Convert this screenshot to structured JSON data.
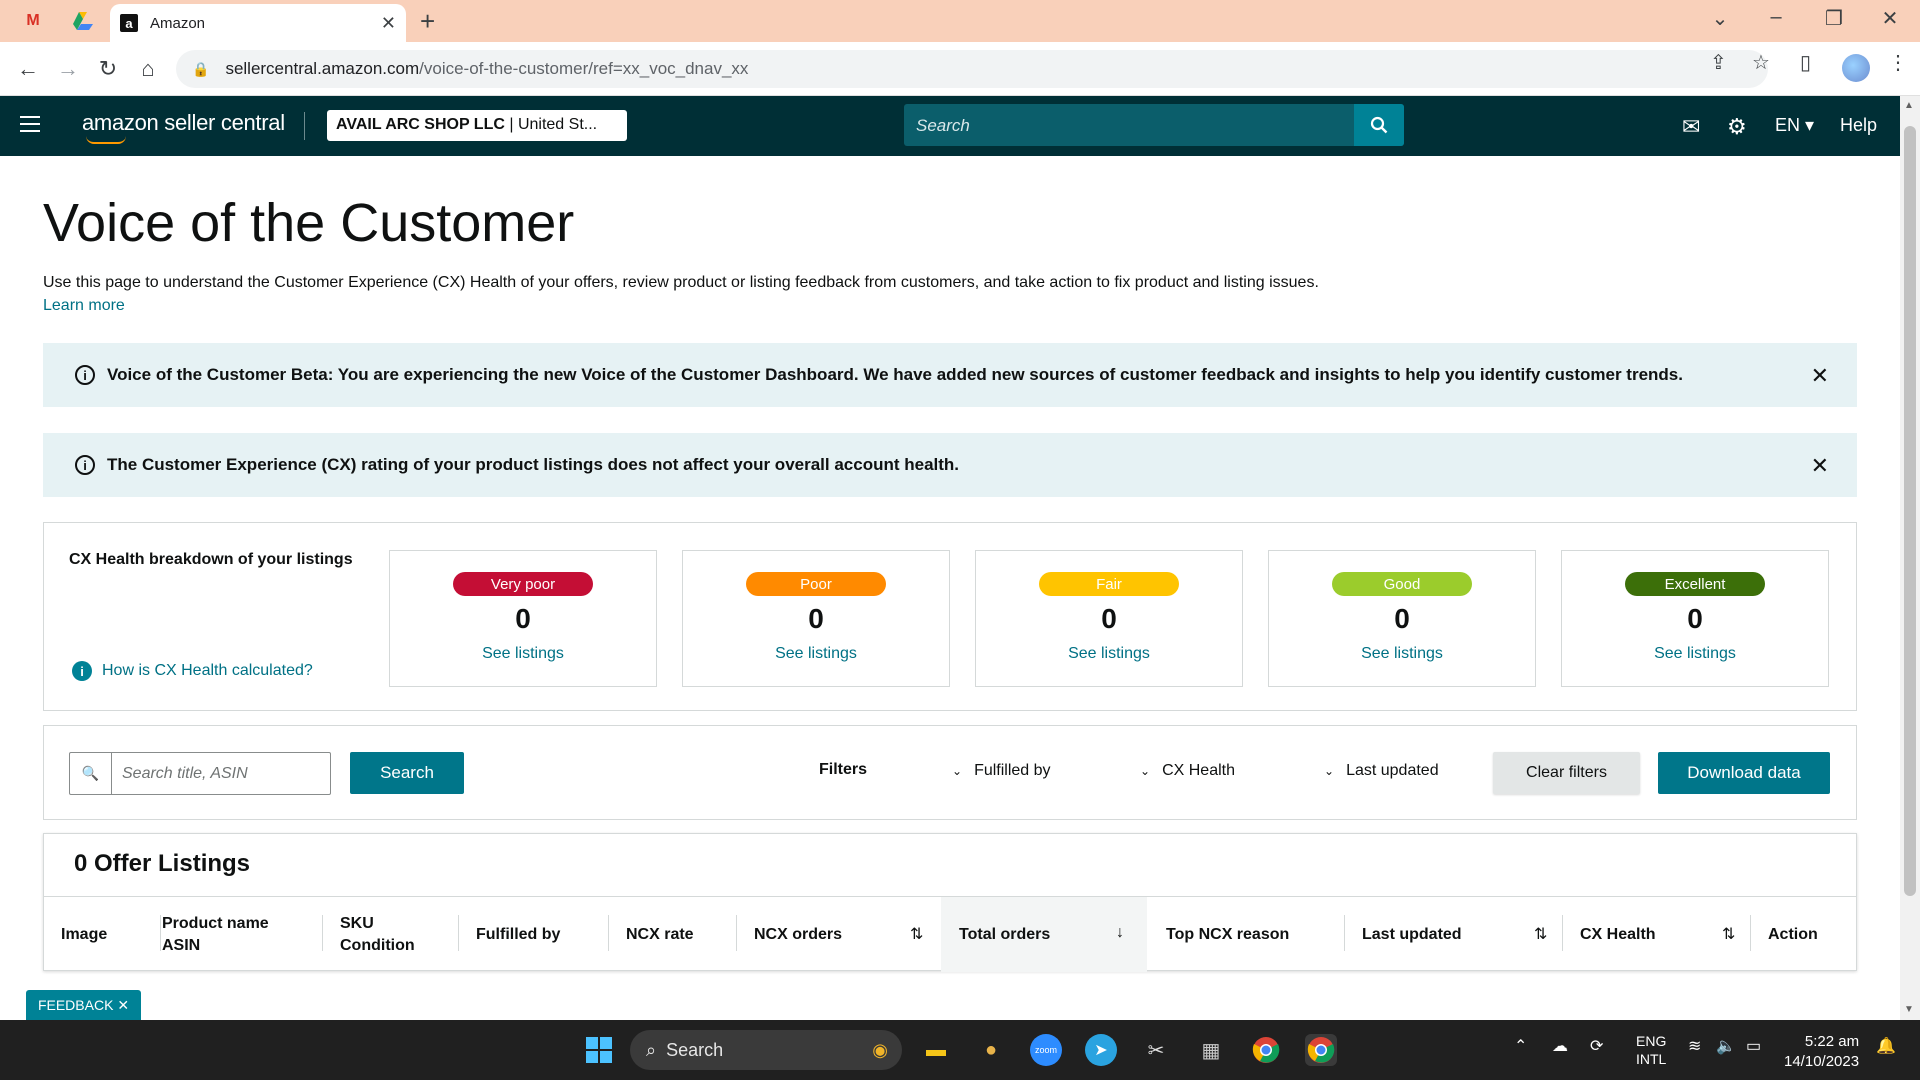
{
  "browser": {
    "tab_title": "Amazon",
    "url_host": "sellercentral.amazon.com",
    "url_path": "/voice-of-the-customer/ref=xx_voc_dnav_xx"
  },
  "header": {
    "logo_text": "amazon seller central",
    "account": "AVAIL ARC SHOP LLC",
    "account_region": "United St...",
    "search_placeholder": "Search",
    "language": "EN",
    "help": "Help"
  },
  "page": {
    "title": "Voice of the Customer",
    "description": "Use this page to understand the Customer Experience (CX) Health of your offers, review product or listing feedback from customers, and take action to fix product and listing issues.",
    "learn_more": "Learn more"
  },
  "alerts": [
    {
      "text": "Voice of the Customer Beta: You are experiencing the new Voice of the Customer Dashboard. We have added new sources of customer feedback and insights to help you identify customer trends."
    },
    {
      "text": "The Customer Experience (CX) rating of your product listings does not affect your overall account health."
    }
  ],
  "health": {
    "label": "CX Health breakdown of your listings",
    "how_link": "How is CX Health calculated?",
    "cards": [
      {
        "label": "Very poor",
        "count": "0",
        "link": "See listings",
        "color": "#c40e35"
      },
      {
        "label": "Poor",
        "count": "0",
        "link": "See listings",
        "color": "#ff8a00"
      },
      {
        "label": "Fair",
        "count": "0",
        "link": "See listings",
        "color": "#ffc400"
      },
      {
        "label": "Good",
        "count": "0",
        "link": "See listings",
        "color": "#9bcc2c"
      },
      {
        "label": "Excellent",
        "count": "0",
        "link": "See listings",
        "color": "#3c6f09"
      }
    ]
  },
  "filters": {
    "search_placeholder": "Search title, ASIN",
    "search_button": "Search",
    "label": "Filters",
    "fulfilled_by": "Fulfilled by",
    "cx_health": "CX Health",
    "last_updated": "Last updated",
    "clear": "Clear filters",
    "download": "Download data"
  },
  "offers": {
    "title": "0 Offer Listings",
    "columns": {
      "image": "Image",
      "product_name": "Product name",
      "asin": "ASIN",
      "sku": "SKU",
      "condition": "Condition",
      "fulfilled_by": "Fulfilled by",
      "ncx_rate": "NCX rate",
      "ncx_orders": "NCX orders",
      "total_orders": "Total orders",
      "top_ncx_reason": "Top NCX reason",
      "last_updated": "Last updated",
      "cx_health": "CX Health",
      "action": "Action"
    }
  },
  "feedback": "FEEDBACK",
  "taskbar": {
    "search": "Search",
    "lang_top": "ENG",
    "lang_bottom": "INTL",
    "time": "5:22 am",
    "date": "14/10/2023"
  },
  "colors": {
    "header_bg": "#002f36",
    "accent": "#008296",
    "link": "#007185",
    "alert_bg": "#e6f2f4"
  }
}
